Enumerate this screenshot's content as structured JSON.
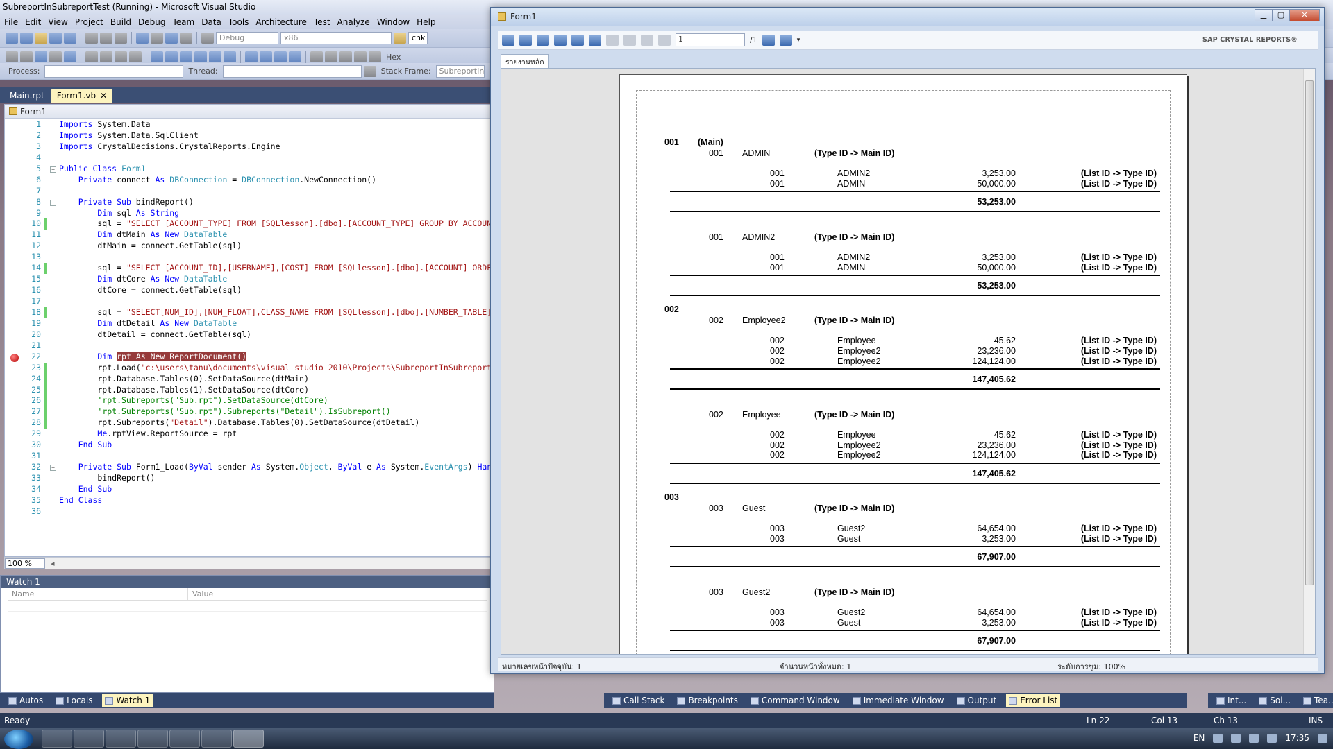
{
  "vs": {
    "title": "SubreportInSubreportTest (Running) - Microsoft Visual Studio",
    "menu": [
      "File",
      "Edit",
      "View",
      "Project",
      "Build",
      "Debug",
      "Team",
      "Data",
      "Tools",
      "Architecture",
      "Test",
      "Analyze",
      "Window",
      "Help"
    ],
    "toolbar": {
      "config": "Debug",
      "platform": "x86",
      "find": "chk",
      "hex": "Hex",
      "process_label": "Process:",
      "thread_label": "Thread:",
      "stack_frame_label": "Stack Frame:",
      "stack_frame_value": "SubreportIn"
    },
    "doc_tabs": [
      "Main.rpt",
      "Form1.vb"
    ],
    "active_doc": "Form1.vb",
    "editor_header": "Form1",
    "code": [
      {
        "n": "1",
        "html": "<span class='kw'>Imports</span> System.Data"
      },
      {
        "n": "2",
        "html": "<span class='kw'>Imports</span> System.Data.SqlClient"
      },
      {
        "n": "3",
        "html": "<span class='kw'>Imports</span> CrystalDecisions.CrystalReports.Engine"
      },
      {
        "n": "4",
        "html": ""
      },
      {
        "n": "5",
        "html": "<span class='kw'>Public Class</span> <span class='ty'>Form1</span>",
        "fold": true
      },
      {
        "n": "6",
        "html": "    <span class='kw'>Private</span> connect <span class='kw'>As</span> <span class='ty'>DBConnection</span> = <span class='ty'>DBConnection</span>.NewConnection()"
      },
      {
        "n": "7",
        "html": ""
      },
      {
        "n": "8",
        "html": "    <span class='kw'>Private Sub</span> bindReport()",
        "fold": true
      },
      {
        "n": "9",
        "html": "        <span class='kw'>Dim</span> sql <span class='kw'>As String</span>"
      },
      {
        "n": "10",
        "html": "        sql = <span class='st'>\"SELECT [ACCOUNT_TYPE] FROM [SQLlesson].[dbo].[ACCOUNT_TYPE] GROUP BY ACCOUN</span>",
        "chg": true
      },
      {
        "n": "11",
        "html": "        <span class='kw'>Dim</span> dtMain <span class='kw'>As New</span> <span class='ty'>DataTable</span>"
      },
      {
        "n": "12",
        "html": "        dtMain = connect.GetTable(sql)"
      },
      {
        "n": "13",
        "html": ""
      },
      {
        "n": "14",
        "html": "        sql = <span class='st'>\"SELECT [ACCOUNT_ID],[USERNAME],[COST] FROM [SQLlesson].[dbo].[ACCOUNT] ORDE</span>",
        "chg": true
      },
      {
        "n": "15",
        "html": "        <span class='kw'>Dim</span> dtCore <span class='kw'>As New</span> <span class='ty'>DataTable</span>"
      },
      {
        "n": "16",
        "html": "        dtCore = connect.GetTable(sql)"
      },
      {
        "n": "17",
        "html": ""
      },
      {
        "n": "18",
        "html": "        sql = <span class='st'>\"SELECT[NUM_ID],[NUM_FLOAT],CLASS_NAME FROM [SQLlesson].[dbo].[NUMBER_TABLE]</span>",
        "chg": true
      },
      {
        "n": "19",
        "html": "        <span class='kw'>Dim</span> dtDetail <span class='kw'>As New</span> <span class='ty'>DataTable</span>"
      },
      {
        "n": "20",
        "html": "        dtDetail = connect.GetTable(sql)"
      },
      {
        "n": "21",
        "html": ""
      },
      {
        "n": "22",
        "html": "        <span class='kw'>Dim</span> <span class='hl'>rpt</span><span class='hl'> As New ReportDocument()</span>",
        "bp": true
      },
      {
        "n": "23",
        "html": "        rpt.Load(<span class='st'>\"c:\\users\\tanu\\documents\\visual studio 2010\\Projects\\SubreportInSubreport</span>",
        "chg": true
      },
      {
        "n": "24",
        "html": "        rpt.Database.Tables(0).SetDataSource(dtMain)",
        "chg": true
      },
      {
        "n": "25",
        "html": "        rpt.Database.Tables(1).SetDataSource(dtCore)",
        "chg": true
      },
      {
        "n": "26",
        "html": "        <span class='cm'>'rpt.Subreports(\"Sub.rpt\").SetDataSource(dtCore)</span>",
        "chg": true
      },
      {
        "n": "27",
        "html": "        <span class='cm'>'rpt.Subreports(\"Sub.rpt\").Subreports(\"Detail\").IsSubreport()</span>",
        "chg": true
      },
      {
        "n": "28",
        "html": "        rpt.Subreports(<span class='st'>\"Detail\"</span>).Database.Tables(0).SetDataSource(dtDetail)",
        "chg": true
      },
      {
        "n": "29",
        "html": "        <span class='kw'>Me</span>.rptView.ReportSource = rpt"
      },
      {
        "n": "30",
        "html": "    <span class='kw'>End Sub</span>"
      },
      {
        "n": "31",
        "html": ""
      },
      {
        "n": "32",
        "html": "    <span class='kw'>Private Sub</span> Form1_Load(<span class='kw'>ByVal</span> sender <span class='kw'>As</span> System.<span class='ty'>Object</span>, <span class='kw'>ByVal</span> e <span class='kw'>As</span> System.<span class='ty'>EventArgs</span>) <span class='kw'>Han</span>",
        "fold": true
      },
      {
        "n": "33",
        "html": "        bindReport()"
      },
      {
        "n": "34",
        "html": "    <span class='kw'>End Sub</span>"
      },
      {
        "n": "35",
        "html": "<span class='kw'>End Class</span>"
      },
      {
        "n": "36",
        "html": ""
      }
    ],
    "zoom": "100 %",
    "watch": {
      "title": "Watch 1",
      "col_name": "Name",
      "col_value": "Value"
    },
    "bottom_left_tabs": [
      "Autos",
      "Locals",
      "Watch 1"
    ],
    "bottom_mid_tabs": [
      "Call Stack",
      "Breakpoints",
      "Command Window",
      "Immediate Window",
      "Output",
      "Error List"
    ],
    "bottom_right_tabs": [
      "Int...",
      "Sol...",
      "Tea..."
    ],
    "status": {
      "ready": "Ready",
      "ln": "Ln 22",
      "col": "Col 13",
      "ch": "Ch 13",
      "ins": "INS"
    },
    "tray": {
      "lang": "EN",
      "time": "17:35"
    }
  },
  "form": {
    "title": "Form1",
    "page_input": "1",
    "page_total": "/1",
    "brand": "SAP CRYSTAL REPORTS®",
    "tab": "รายงานหลัก",
    "status": {
      "current_page": "หมายเลขหน้าปัจจุบัน: 1",
      "total_pages": "จำนวนหน้าทั้งหมด: 1",
      "zoom": "ระดับการซูม: 100%"
    },
    "report": {
      "main_label": "(Main)",
      "sub_tag": "(Type ID -> Main ID)",
      "detail_tag": "(List ID -> Type ID)",
      "groups": [
        {
          "id": "001",
          "subs": [
            {
              "id": "001",
              "name": "ADMIN",
              "rows": [
                [
                  "001",
                  "ADMIN2",
                  "3,253.00"
                ],
                [
                  "001",
                  "ADMIN",
                  "50,000.00"
                ]
              ],
              "total": "53,253.00"
            },
            {
              "id": "001",
              "name": "ADMIN2",
              "rows": [
                [
                  "001",
                  "ADMIN2",
                  "3,253.00"
                ],
                [
                  "001",
                  "ADMIN",
                  "50,000.00"
                ]
              ],
              "total": "53,253.00"
            }
          ]
        },
        {
          "id": "002",
          "subs": [
            {
              "id": "002",
              "name": "Employee2",
              "rows": [
                [
                  "002",
                  "Employee",
                  "45.62"
                ],
                [
                  "002",
                  "Employee2",
                  "23,236.00"
                ],
                [
                  "002",
                  "Employee2",
                  "124,124.00"
                ]
              ],
              "total": "147,405.62"
            },
            {
              "id": "002",
              "name": "Employee",
              "rows": [
                [
                  "002",
                  "Employee",
                  "45.62"
                ],
                [
                  "002",
                  "Employee2",
                  "23,236.00"
                ],
                [
                  "002",
                  "Employee2",
                  "124,124.00"
                ]
              ],
              "total": "147,405.62"
            }
          ]
        },
        {
          "id": "003",
          "subs": [
            {
              "id": "003",
              "name": "Guest",
              "rows": [
                [
                  "003",
                  "Guest2",
                  "64,654.00"
                ],
                [
                  "003",
                  "Guest",
                  "3,253.00"
                ]
              ],
              "total": "67,907.00"
            },
            {
              "id": "003",
              "name": "Guest2",
              "rows": [
                [
                  "003",
                  "Guest2",
                  "64,654.00"
                ],
                [
                  "003",
                  "Guest",
                  "3,253.00"
                ]
              ],
              "total": "67,907.00"
            }
          ]
        }
      ]
    }
  }
}
